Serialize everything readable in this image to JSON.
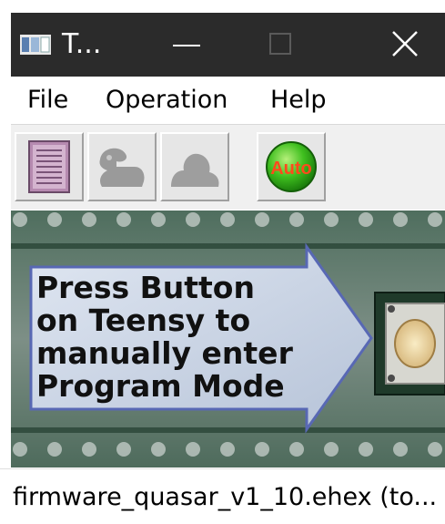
{
  "window": {
    "title": "T...",
    "icon": "teensy-loader-app-icon",
    "controls": {
      "minimize_icon": "minimize-icon",
      "maximize_icon": "maximize-icon",
      "close_icon": "close-icon"
    }
  },
  "menubar": {
    "items": [
      {
        "label": "File"
      },
      {
        "label": "Operation"
      },
      {
        "label": "Help"
      }
    ]
  },
  "toolbar": {
    "buttons": [
      {
        "name": "log-window",
        "icon": "document-list-icon"
      },
      {
        "name": "program",
        "icon": "program-icon",
        "enabled": false
      },
      {
        "name": "reboot",
        "icon": "reboot-icon",
        "enabled": false
      },
      {
        "name": "auto",
        "icon": "auto-icon",
        "label": "Auto",
        "color": "#2aa31a"
      }
    ]
  },
  "main": {
    "instruction_lines": [
      "Press Button",
      "on Teensy to",
      "manually enter",
      "Program Mode"
    ]
  },
  "status": {
    "text": "firmware_quasar_v1_10.ehex (to..."
  }
}
